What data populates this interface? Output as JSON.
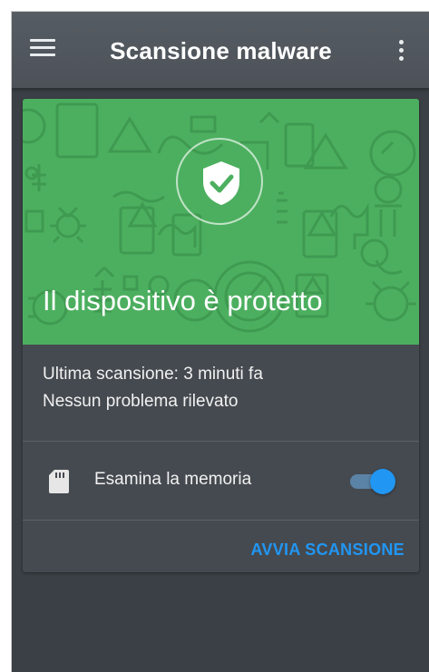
{
  "appbar": {
    "title": "Scansione malware",
    "menu_icon": "hamburger-menu-icon",
    "more_icon": "more-vert-icon"
  },
  "status_card": {
    "status_text": "Il dispositivo è protetto",
    "status_icon": "shield-check-icon",
    "status_color": "#4caf5f",
    "last_scan": "Ultima scansione: 3 minuti fa",
    "problems": "Nessun problema rilevato",
    "memory_option": {
      "label": "Esamina la memoria",
      "icon": "sd-card-icon",
      "enabled": true
    },
    "scan_button_label": "AVVIA SCANSIONE",
    "accent_color": "#2196f3"
  }
}
